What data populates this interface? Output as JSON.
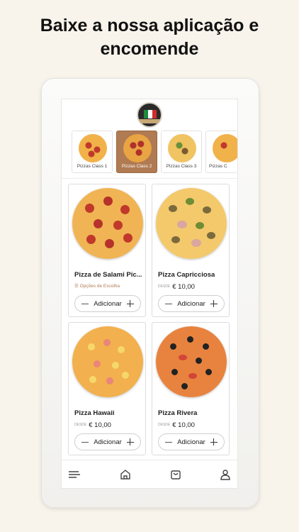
{
  "headline": "Baixe a nossa aplicação e encomende",
  "logo": {
    "icon": "restaurant-logo-icon",
    "flag_colors": [
      "#1f8a3b",
      "#ffffff",
      "#d22b2b"
    ]
  },
  "categories": [
    {
      "label": "Pizzas Class 1",
      "active": false
    },
    {
      "label": "Pizzas Class 2",
      "active": true
    },
    {
      "label": "Pizzas Class 3",
      "active": false
    },
    {
      "label": "Pizzas C",
      "active": false
    }
  ],
  "products": [
    {
      "name": "Pizza de Salami Pic...",
      "options_label": "Opções de Escolha",
      "add_label": "Adicionar"
    },
    {
      "name": "Pizza Capricciosa",
      "price_from": "DESDE",
      "price": "€ 10,00",
      "add_label": "Adicionar"
    },
    {
      "name": "Pizza Hawaii",
      "price_from": "DESDE",
      "price": "€ 10,00",
      "add_label": "Adicionar"
    },
    {
      "name": "Pizza Rivera",
      "price_from": "DESDE",
      "price": "€ 10,00",
      "add_label": "Adicionar"
    }
  ],
  "bottom_nav": [
    "menu-icon",
    "home-icon",
    "cart-icon",
    "user-icon"
  ],
  "colors": {
    "accent": "#b07a52",
    "background": "#f8f4ec"
  }
}
